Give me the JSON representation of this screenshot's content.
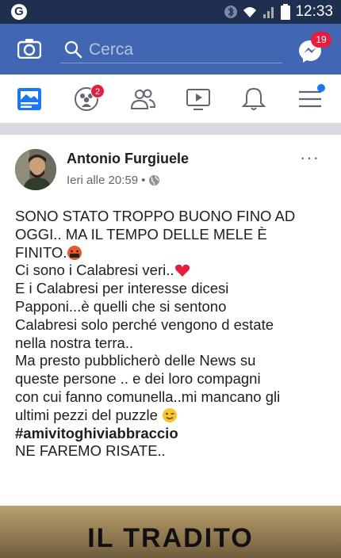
{
  "status_bar": {
    "time": "12:33",
    "icons": [
      "app-notification-icon",
      "bluetooth-icon",
      "wifi-icon",
      "signal-icon",
      "battery-icon"
    ]
  },
  "fb_header": {
    "search_placeholder": "Cerca",
    "messenger_badge": "19",
    "brand_color": "#4267b2",
    "badge_color": "#e41e3f"
  },
  "nav": {
    "items": [
      "news-feed-icon",
      "groups-icon",
      "friends-icon",
      "watch-icon",
      "notifications-icon",
      "menu-icon"
    ],
    "groups_badge": "2"
  },
  "post": {
    "author": "Antonio Furgiuele",
    "timestamp": "Ieri alle 20:59",
    "separator": "•",
    "more": "···",
    "lines": [
      "SONO STATO TROPPO BUONO FINO AD",
      "OGGI.. MA IL TEMPO DELLE MELE  È",
      "FINITO.",
      "Ci sono i Calabresi veri..",
      "E i Calabresi per interesse dicesi",
      "Papponi...è quelli che si sentono",
      "Calabresi solo perché vengono d estate",
      "nella nostra terra..",
      "Ma presto pubblicherò delle News su",
      "queste persone .. e dei loro compagni",
      "con cui fanno comunella..mi mancano gli",
      "ultimi pezzi del puzzle ",
      "#amivitoghiviabbraccio",
      "NE FAREMO RISATE.."
    ],
    "link_image_title": "IL TRADITO"
  }
}
